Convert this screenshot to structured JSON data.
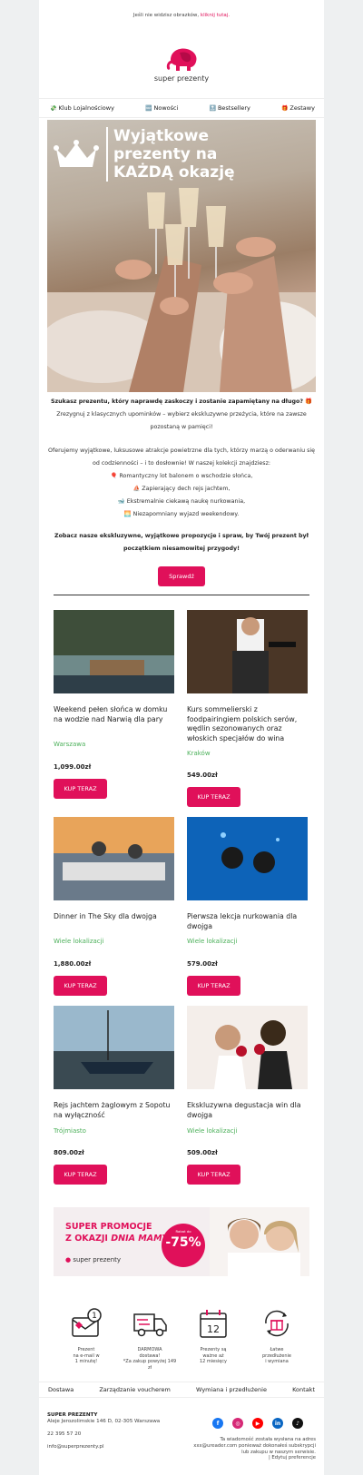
{
  "topnote": {
    "text": "Jeśli nie widzisz obrazków,",
    "link": "kliknij tutaj."
  },
  "brand": {
    "name": "super prezenty",
    "accent": "#e0105a"
  },
  "nav": [
    {
      "icon": "💸",
      "label": "Klub Lojalnościowy"
    },
    {
      "icon": "🆕",
      "label": "Nowości"
    },
    {
      "icon": "🔝",
      "label": "Bestsellery"
    },
    {
      "icon": "🎁",
      "label": "Zestawy"
    }
  ],
  "hero": {
    "line1": "Wyjątkowe",
    "line2": "prezenty na",
    "line3": "KAŻDĄ okazję"
  },
  "intro": {
    "bold1": "Szukasz prezentu, który naprawdę zaskoczy i zostanie zapamiętany na długo? 🎁",
    "p1": "Zrezygnuj z klasycznych upominków – wybierz ekskluzywne przeżycia, które na zawsze pozostaną w pamięci!",
    "p2": "Oferujemy wyjątkowe, luksusowe atrakcje powietrzne dla tych, którzy marzą o oderwaniu się od codzienności – i to dosłownie! W naszej kolekcji znajdziesz:",
    "b1": "🎈 Romantyczny lot balonem o wschodzie słońca,",
    "b2": "⛵ Zapierający dech rejs jachtem,",
    "b3": "🐋 Ekstremalnie ciekawą naukę nurkowania,",
    "b4": "🌅 Niezapomniany wyjazd weekendowy.",
    "bold2": "Zobacz nasze ekskluzywne, wyjątkowe propozycje i spraw, by Twój prezent był początkiem niesamowitej przygody!",
    "cta": "Sprawdź"
  },
  "products": [
    {
      "name": "Weekend pełen słońca w domku na wodzie nad Narwią dla pary",
      "loc": "Warszawa",
      "price": "1,099.00zł",
      "buy": "KUP TERAZ"
    },
    {
      "name": "Kurs sommelierski z foodpairingiem polskich serów, wędlin sezonowanych oraz włoskich specjałów do wina",
      "loc": "Kraków",
      "price": "549.00zł",
      "buy": "KUP TERAZ"
    },
    {
      "name": "Dinner in The Sky dla dwojga",
      "loc": "Wiele lokalizacji",
      "price": "1,880.00zł",
      "buy": "KUP TERAZ"
    },
    {
      "name": "Pierwsza lekcja nurkowania dla dwojga",
      "loc": "Wiele lokalizacji",
      "price": "579.00zł",
      "buy": "KUP TERAZ"
    },
    {
      "name": "Rejs jachtem żaglowym z Sopotu na wyłączność",
      "loc": "Trójmiasto",
      "price": "809.00zł",
      "buy": "KUP TERAZ"
    },
    {
      "name": "Ekskluzywna degustacja win dla dwojga",
      "loc": "Wiele lokalizacji",
      "price": "509.00zł",
      "buy": "KUP TERAZ"
    }
  ],
  "promo": {
    "line1": "SUPER PROMOCJE",
    "line2a": "Z OKAZJI ",
    "line2b": "DNIA MAMY!",
    "badge_small": "Rabat do",
    "badge_big": "-75%",
    "brand": "super prezenty"
  },
  "features": [
    {
      "icon": "envelope-1-icon",
      "l1": "Prezent",
      "l2": "na e-mail w",
      "l3": "1 minutę!"
    },
    {
      "icon": "truck-icon",
      "l1": "DARMOWA",
      "l2": "dostawa!",
      "l3": "*Za zakup powyżej 149 zł"
    },
    {
      "icon": "calendar-12-icon",
      "l1": "Prezenty są",
      "l2": "ważne aż",
      "l3": "12 miesięcy"
    },
    {
      "icon": "gift-refresh-icon",
      "l1": "Łatwe",
      "l2": "przedłużenie",
      "l3": "i wymiana"
    }
  ],
  "footer_links": [
    "Dostawa",
    "Zarządzanie voucherem",
    "Wymiana i przedłużenie",
    "Kontakt"
  ],
  "company": {
    "name": "SUPER PREZENTY",
    "address": "Aleje Jerozolimskie 146 D, 02-305 Warszawa",
    "phone": "22 395 57 20",
    "email": "info@superprezenty.pl"
  },
  "legal": {
    "l1": "Ta wiadomość została wysłana na adres",
    "l2": "xxx@ureader.com ponieważ dokonałeś subskrypcji",
    "l3": "lub zakupu w naszym serwisie.",
    "l4": "| Edytuj preferencje"
  }
}
